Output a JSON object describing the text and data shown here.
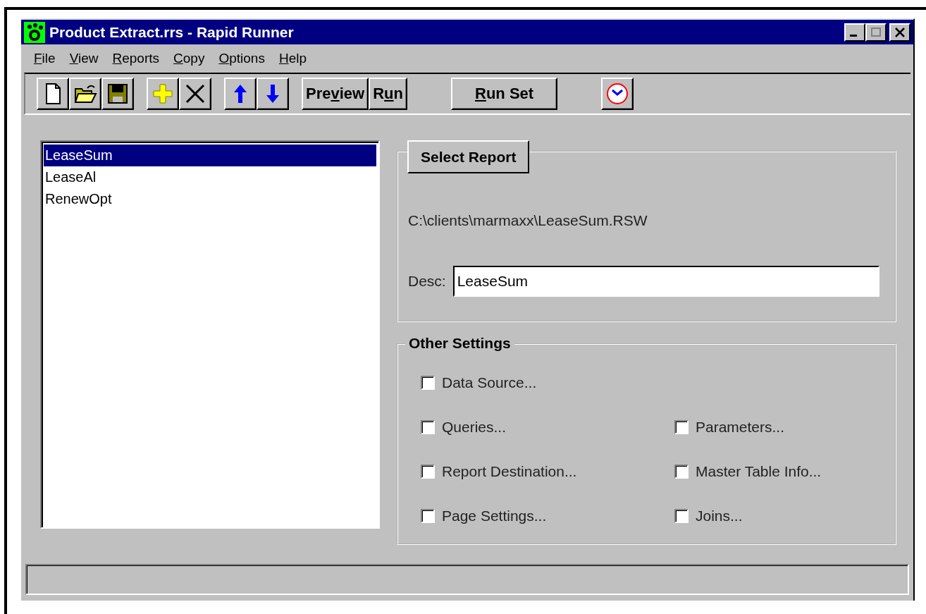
{
  "window": {
    "title": "Product Extract.rrs - Rapid Runner"
  },
  "menu": [
    {
      "key": "F",
      "rest": "ile"
    },
    {
      "key": "V",
      "rest": "iew"
    },
    {
      "key": "R",
      "rest": "eports"
    },
    {
      "key": "C",
      "rest": "opy"
    },
    {
      "key": "O",
      "rest": "ptions"
    },
    {
      "key": "H",
      "rest": "elp"
    }
  ],
  "toolbar": [
    [
      {
        "kind": "new"
      },
      {
        "kind": "open"
      },
      {
        "kind": "save"
      }
    ],
    [
      {
        "kind": "add"
      },
      {
        "kind": "delete"
      }
    ],
    [
      {
        "kind": "up"
      },
      {
        "kind": "down"
      }
    ],
    [
      {
        "kind": "text",
        "lead": "Pre",
        "key": "v",
        "rest": "iew"
      },
      {
        "kind": "text",
        "lead": "R",
        "key": "u",
        "rest": "n"
      }
    ],
    [
      {
        "kind": "wide_text",
        "key": "R",
        "rest": "un Set"
      }
    ],
    [
      {
        "kind": "clock"
      }
    ]
  ],
  "reports": [
    {
      "label": "LeaseSum",
      "selected": true
    },
    {
      "label": "LeaseAl",
      "selected": false
    },
    {
      "label": "RenewOpt",
      "selected": false
    }
  ],
  "select_report": {
    "button": "Select Report",
    "path": "C:\\clients\\marmaxx\\LeaseSum.RSW",
    "desc_label": "Desc:",
    "desc_value": "LeaseSum"
  },
  "other_settings": {
    "title": "Other Settings",
    "rows": [
      [
        {
          "label": "Data Source...",
          "checked": false
        }
      ],
      [
        {
          "label": "Queries...",
          "checked": false
        },
        {
          "label": "Parameters...",
          "checked": false
        }
      ],
      [
        {
          "label": "Report Destination...",
          "checked": false
        },
        {
          "label": "Master Table Info...",
          "checked": false
        }
      ],
      [
        {
          "label": "Page Settings...",
          "checked": false
        },
        {
          "label": "Joins...",
          "checked": false
        }
      ]
    ]
  }
}
